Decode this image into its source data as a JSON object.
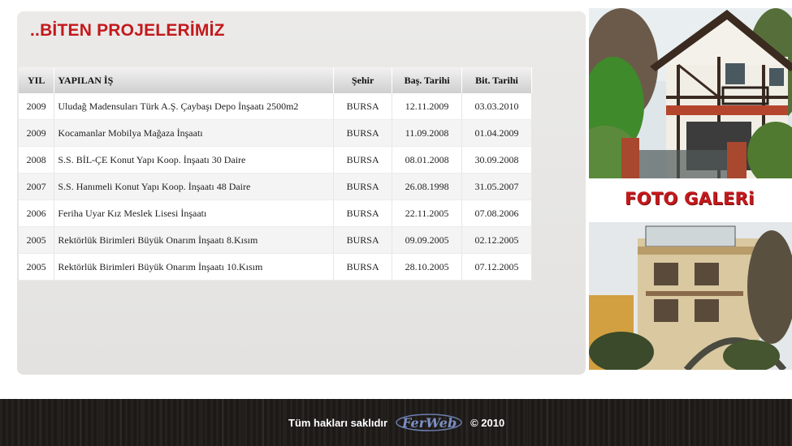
{
  "section": {
    "title": "..BİTEN PROJELERİMİZ"
  },
  "table": {
    "headers": {
      "year": "YIL",
      "work": "YAPILAN İŞ",
      "city": "Şehir",
      "start": "Baş. Tarihi",
      "end": "Bit. Tarihi"
    },
    "rows": [
      {
        "year": "2009",
        "work": "Uludağ Madensuları Türk A.Ş. Çaybaşı Depo İnşaatı 2500m2",
        "city": "BURSA",
        "start": "12.11.2009",
        "end": "03.03.2010"
      },
      {
        "year": "2009",
        "work": "Kocamanlar Mobilya Mağaza İnşaatı",
        "city": "BURSA",
        "start": "11.09.2008",
        "end": "01.04.2009"
      },
      {
        "year": "2008",
        "work": "S.S. BİL-ÇE Konut Yapı Koop. İnşaatı 30 Daire",
        "city": "BURSA",
        "start": "08.01.2008",
        "end": "30.09.2008"
      },
      {
        "year": "2007",
        "work": "S.S. Hanımeli Konut Yapı Koop. İnşaatı 48 Daire",
        "city": "BURSA",
        "start": "26.08.1998",
        "end": "31.05.2007"
      },
      {
        "year": "2006",
        "work": "Feriha Uyar Kız Meslek Lisesi İnşaatı",
        "city": "BURSA",
        "start": "22.11.2005",
        "end": "07.08.2006"
      },
      {
        "year": "2005",
        "work": "Rektörlük Birimleri Büyük Onarım İnşaatı 8.Kısım",
        "city": "BURSA",
        "start": "09.09.2005",
        "end": "02.12.2005"
      },
      {
        "year": "2005",
        "work": "Rektörlük Birimleri Büyük Onarım İnşaatı 10.Kısım",
        "city": "BURSA",
        "start": "28.10.2005",
        "end": "07.12.2005"
      }
    ]
  },
  "gallery": {
    "title": "FOTO GALERi"
  },
  "footer": {
    "rights": "Tüm hakları saklıdır",
    "logo_text": "FerWeb",
    "copyright": "© 2010"
  },
  "colors": {
    "accent_red": "#c4191c",
    "panel_gray": "#e8e7e5",
    "footer_dark": "#1d1a18"
  }
}
